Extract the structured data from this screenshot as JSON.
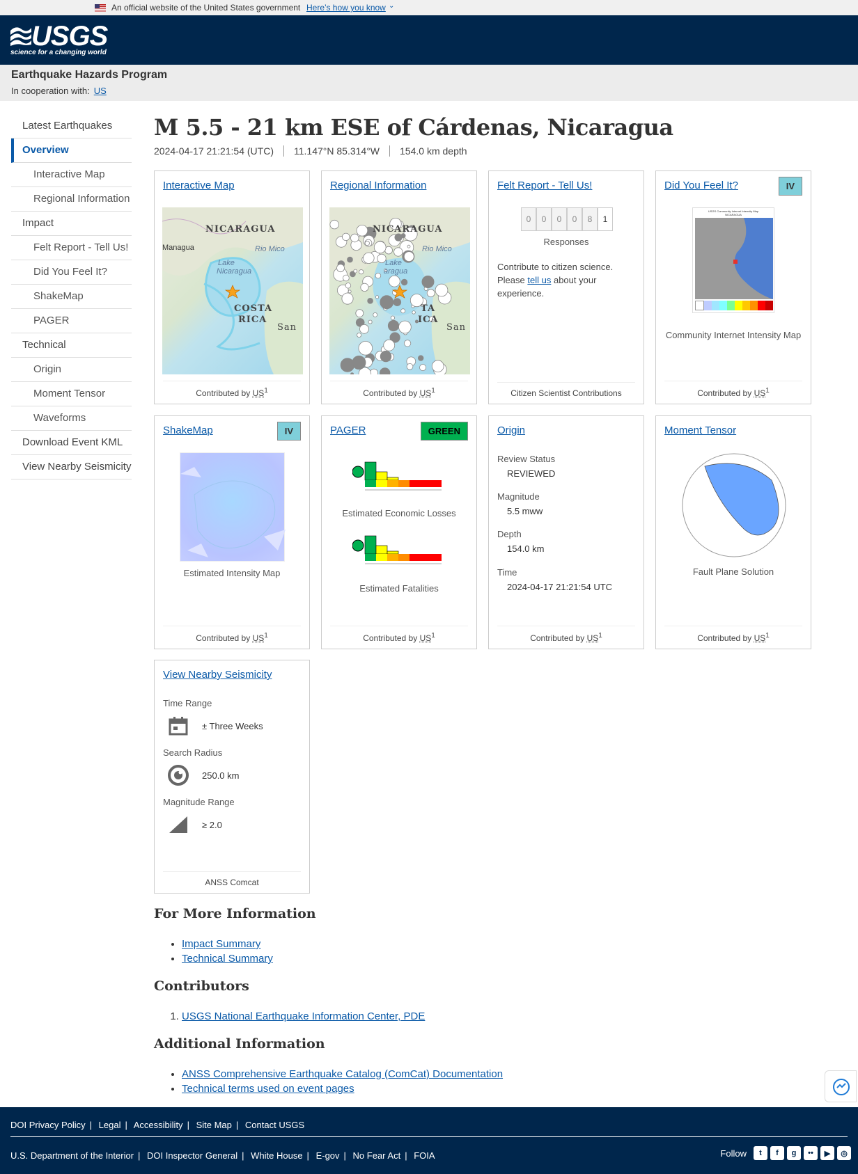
{
  "gov_banner": {
    "text": "An official website of the United States government",
    "link": "Here’s how you know"
  },
  "header": {
    "logo": "USGS",
    "tagline": "science for a changing world"
  },
  "site": {
    "title": "Earthquake Hazards Program",
    "coop_label": "In cooperation with:",
    "coop_link": "US"
  },
  "nav": {
    "latest": "Latest Earthquakes",
    "overview": "Overview",
    "interactive_map": "Interactive Map",
    "regional_info": "Regional Information",
    "impact": "Impact",
    "felt_report": "Felt Report - Tell Us!",
    "dyfi": "Did You Feel It?",
    "shakemap": "ShakeMap",
    "pager": "PAGER",
    "technical": "Technical",
    "origin": "Origin",
    "moment_tensor": "Moment Tensor",
    "waveforms": "Waveforms",
    "download_kml": "Download Event KML",
    "nearby": "View Nearby Seismicity"
  },
  "event": {
    "title": "M 5.5 - 21 km ESE of Cárdenas, Nicaragua",
    "time": "2024-04-17 21:21:54 (UTC)",
    "location": "11.147°N 85.314°W",
    "depth": "154.0 km depth"
  },
  "cards": {
    "interactive_map": {
      "title": "Interactive Map",
      "foot": "Contributed by US",
      "sup": "1",
      "labels": {
        "country1": "NICARAGUA",
        "city1": "Managua",
        "river": "Rio Mico",
        "lake1": "Lake",
        "lake2": "Nicaragua",
        "country2": "COSTA",
        "country2b": "RICA",
        "city2": "San"
      }
    },
    "regional": {
      "title": "Regional Information",
      "foot": "Contributed by US",
      "sup": "1",
      "labels": {
        "country1": "NICARAGUA",
        "river": "Rio Mico",
        "lake1": "Lake",
        "lake2": "aragua",
        "country2": "TA",
        "country2b": "ICA",
        "city2": "San"
      }
    },
    "felt": {
      "title": "Felt Report - Tell Us!",
      "digits": [
        "0",
        "0",
        "0",
        "0",
        "8",
        "1"
      ],
      "responses": "Responses",
      "para_before": "Contribute to citizen science. Please",
      "para_link": "tell us",
      "para_after": "about your experience.",
      "foot": "Citizen Scientist Contributions"
    },
    "dyfi": {
      "title": "Did You Feel It?",
      "badge": "IV",
      "badge_color": "#7fcfda",
      "caption": "Community Internet Intensity Map",
      "foot": "Contributed by US",
      "sup": "1",
      "map_title": "USGS Community Internet Intensity Map",
      "map_sub": "NICARAGUA"
    },
    "shakemap": {
      "title": "ShakeMap",
      "badge": "IV",
      "badge_color": "#7fcfda",
      "caption": "Estimated Intensity Map",
      "foot": "Contributed by US",
      "sup": "1"
    },
    "pager": {
      "title": "PAGER",
      "badge": "GREEN",
      "badge_color": "#00b050",
      "loss_caption": "Estimated Economic Losses",
      "fat_caption": "Estimated Fatalities",
      "foot": "Contributed by US",
      "sup": "1"
    },
    "origin": {
      "title": "Origin",
      "fields": [
        {
          "k": "Review Status",
          "v": "REVIEWED"
        },
        {
          "k": "Magnitude",
          "v": "5.5 mww"
        },
        {
          "k": "Depth",
          "v": "154.0 km"
        },
        {
          "k": "Time",
          "v": "2024-04-17 21:21:54 UTC"
        }
      ],
      "foot": "Contributed by US",
      "sup": "1"
    },
    "moment": {
      "title": "Moment Tensor",
      "caption": "Fault Plane Solution",
      "foot": "Contributed by US",
      "sup": "1"
    },
    "nearby": {
      "title": "View Nearby Seismicity",
      "time_label": "Time Range",
      "time_value": "± Three Weeks",
      "radius_label": "Search Radius",
      "radius_value": "250.0 km",
      "mag_label": "Magnitude Range",
      "mag_value": "≥ 2.0",
      "foot": "ANSS Comcat"
    }
  },
  "more_info": {
    "heading": "For More Information",
    "links": [
      "Impact Summary",
      "Technical Summary"
    ]
  },
  "contributors": {
    "heading": "Contributors",
    "items": [
      "USGS National Earthquake Information Center, PDE"
    ]
  },
  "additional": {
    "heading": "Additional Information",
    "links": [
      "ANSS Comprehensive Earthquake Catalog (ComCat) Documentation",
      "Technical terms used on event pages"
    ]
  },
  "footer": {
    "row1": [
      "DOI Privacy Policy",
      "Legal",
      "Accessibility",
      "Site Map",
      "Contact USGS"
    ],
    "row2": [
      "U.S. Department of the Interior",
      "DOI Inspector General",
      "White House",
      "E-gov",
      "No Fear Act",
      "FOIA"
    ],
    "follow": "Follow",
    "social": [
      "twitter-icon",
      "facebook-icon",
      "github-icon",
      "flickr-icon",
      "youtube-icon",
      "instagram-icon"
    ]
  }
}
